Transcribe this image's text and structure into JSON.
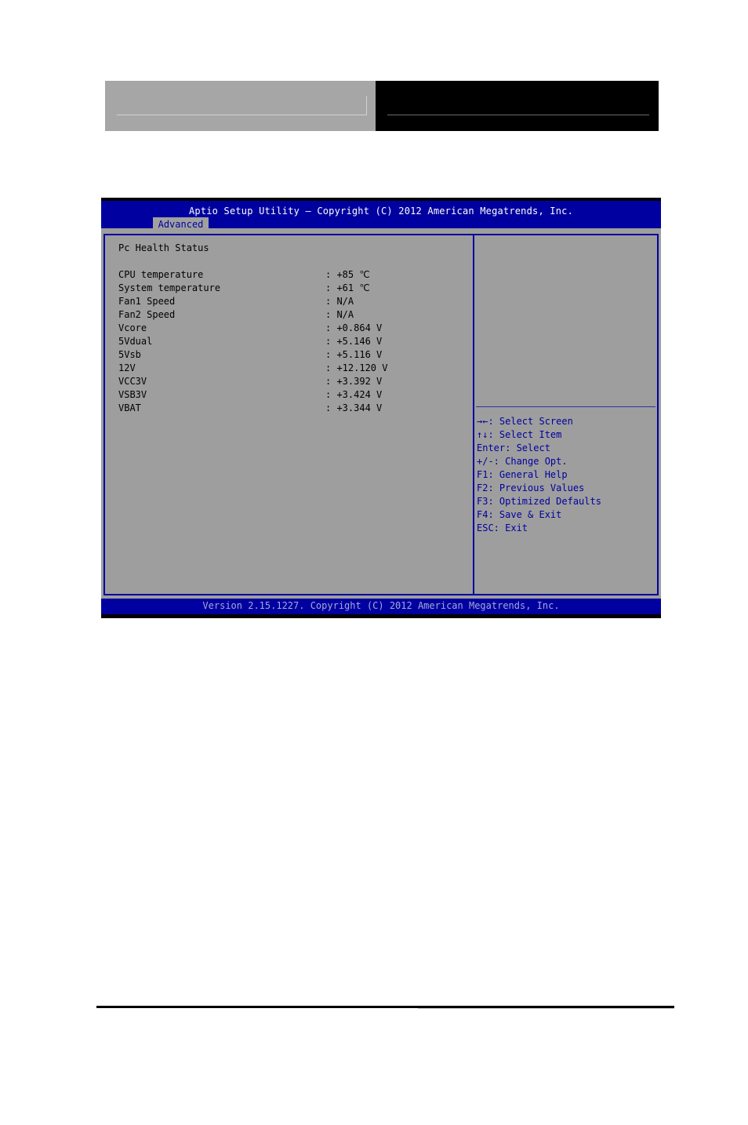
{
  "bios": {
    "title": "Aptio Setup Utility – Copyright (C) 2012 American Megatrends, Inc.",
    "active_tab": "Advanced",
    "section_title": "Pc Health Status",
    "readings": [
      {
        "label": "CPU temperature",
        "value": ": +85 ℃"
      },
      {
        "label": "System temperature",
        "value": ": +61 ℃"
      },
      {
        "label": "Fan1 Speed",
        "value": ": N/A"
      },
      {
        "label": "Fan2 Speed",
        "value": ": N/A"
      },
      {
        "label": "Vcore",
        "value": ": +0.864 V"
      },
      {
        "label": "5Vdual",
        "value": ": +5.146 V"
      },
      {
        "label": "5Vsb",
        "value": ": +5.116 V"
      },
      {
        "label": "12V",
        "value": ": +12.120 V"
      },
      {
        "label": "VCC3V",
        "value": ": +3.392 V"
      },
      {
        "label": "VSB3V",
        "value": ": +3.424 V"
      },
      {
        "label": "VBAT",
        "value": ": +3.344 V"
      }
    ],
    "help": [
      "→←: Select Screen",
      "↑↓: Select Item",
      "Enter: Select",
      "+/-: Change Opt.",
      "F1: General Help",
      "F2: Previous Values",
      "F3: Optimized Defaults",
      "F4: Save & Exit",
      "ESC: Exit"
    ],
    "footer": "Version 2.15.1227. Copyright (C) 2012 American Megatrends, Inc."
  },
  "colors": {
    "bios_blue": "#0000a0",
    "bios_gray": "#9e9e9e",
    "header_gray": "#a6a6a6",
    "header_black": "#000000"
  }
}
